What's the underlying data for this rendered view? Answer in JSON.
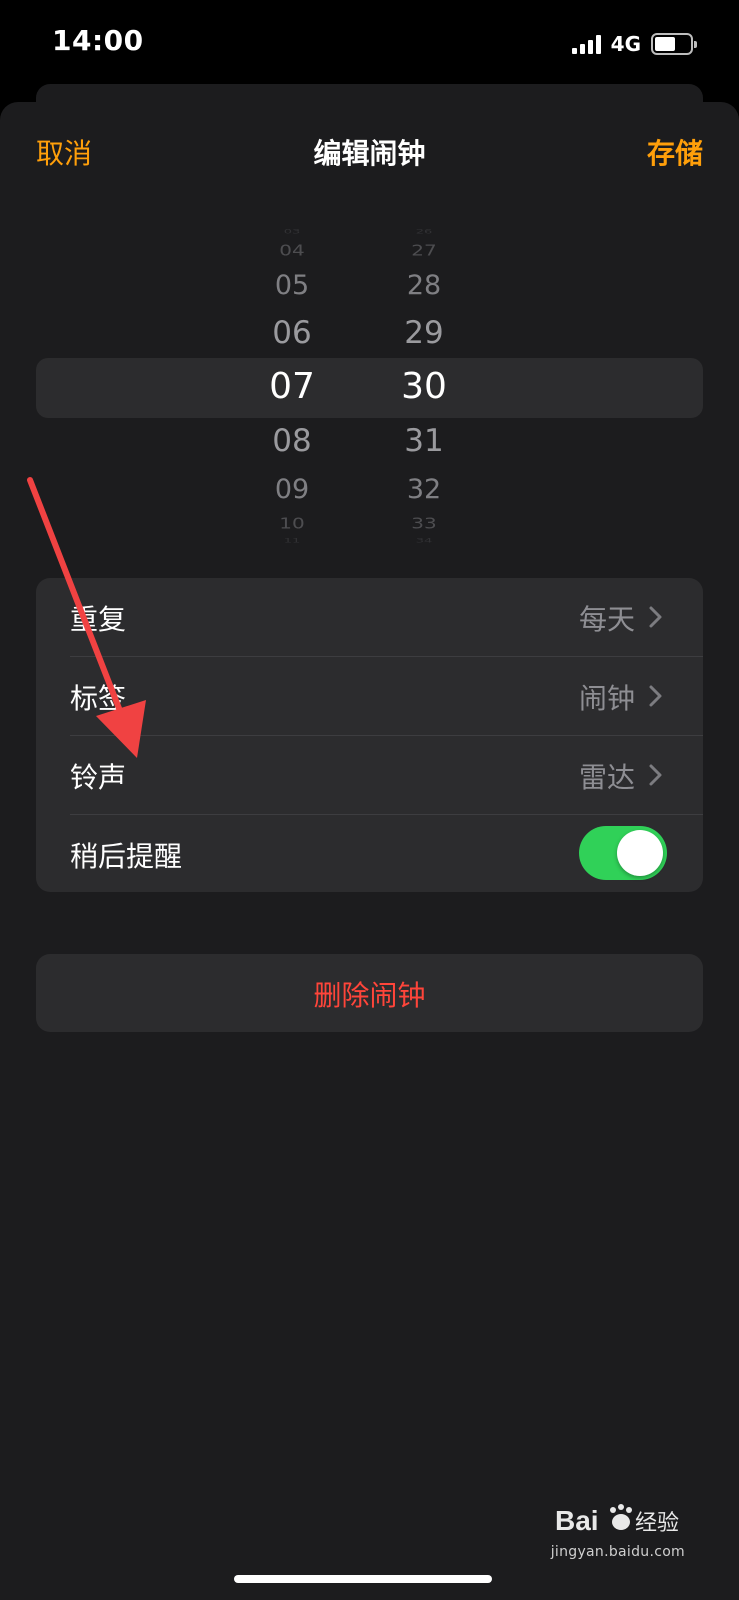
{
  "status_bar": {
    "time": "14:00",
    "network": "4G",
    "battery_fill": 0.55
  },
  "nav": {
    "cancel": "取消",
    "title": "编辑闹钟",
    "save": "存储"
  },
  "colors": {
    "accent": "#ff9f0a",
    "destructive": "#ff453a",
    "toggle_on": "#30d158"
  },
  "picker": {
    "hour": {
      "items": [
        "03",
        "04",
        "05",
        "06",
        "07",
        "08",
        "09",
        "10",
        "11"
      ],
      "selected": "07"
    },
    "minute": {
      "items": [
        "26",
        "27",
        "28",
        "29",
        "30",
        "31",
        "32",
        "33",
        "34"
      ],
      "selected": "30"
    }
  },
  "settings": {
    "repeat": {
      "label": "重复",
      "value": "每天"
    },
    "label": {
      "label": "标签",
      "value": "闹钟"
    },
    "sound": {
      "label": "铃声",
      "value": "雷达"
    },
    "snooze": {
      "label": "稍后提醒",
      "on": true
    }
  },
  "delete_label": "删除闹钟",
  "watermark": {
    "text": "jingyan.baidu.com"
  }
}
